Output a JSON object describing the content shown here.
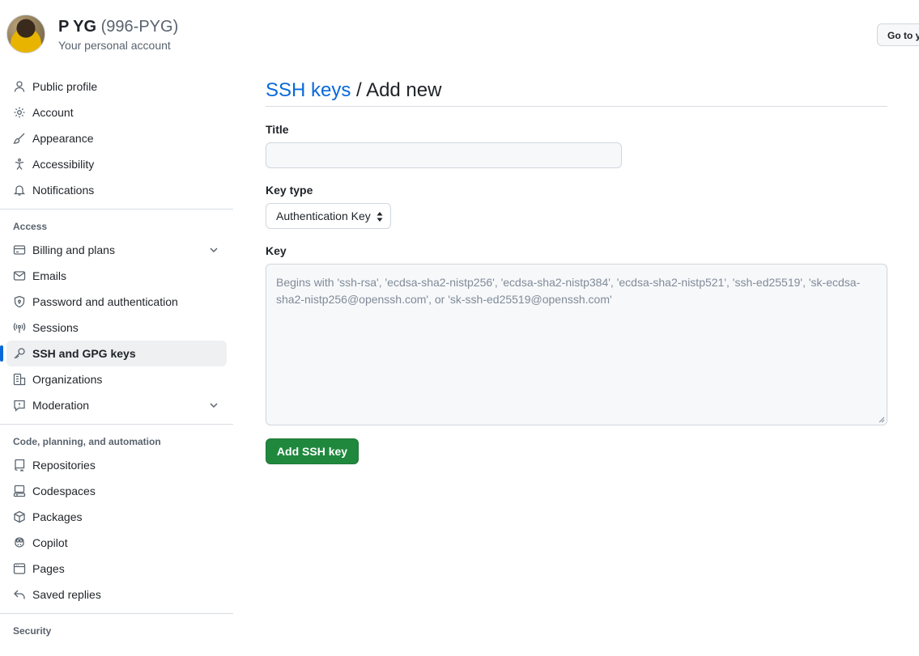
{
  "header": {
    "user_name": "P YG",
    "user_handle": "(996-PYG)",
    "account_sub": "Your personal account",
    "goto_label": "Go to your personal profile"
  },
  "sidebar": {
    "primary": [
      {
        "label": "Public profile",
        "icon": "person-icon"
      },
      {
        "label": "Account",
        "icon": "gear-icon"
      },
      {
        "label": "Appearance",
        "icon": "paintbrush-icon"
      },
      {
        "label": "Accessibility",
        "icon": "accessibility-icon"
      },
      {
        "label": "Notifications",
        "icon": "bell-icon"
      }
    ],
    "access_title": "Access",
    "access": [
      {
        "label": "Billing and plans",
        "icon": "credit-card-icon"
      },
      {
        "label": "Emails",
        "icon": "mail-icon"
      },
      {
        "label": "Password and authentication",
        "icon": "shield-lock-icon"
      },
      {
        "label": "Sessions",
        "icon": "broadcast-icon"
      },
      {
        "label": "SSH and GPG keys",
        "icon": "key-icon"
      },
      {
        "label": "Organizations",
        "icon": "organization-icon"
      },
      {
        "label": "Moderation",
        "icon": "report-icon"
      }
    ],
    "code_title": "Code, planning, and automation",
    "code": [
      {
        "label": "Repositories",
        "icon": "repo-icon"
      },
      {
        "label": "Codespaces",
        "icon": "codespaces-icon"
      },
      {
        "label": "Packages",
        "icon": "package-icon"
      },
      {
        "label": "Copilot",
        "icon": "copilot-icon"
      },
      {
        "label": "Pages",
        "icon": "browser-icon"
      },
      {
        "label": "Saved replies",
        "icon": "reply-icon"
      }
    ],
    "security_title": "Security",
    "active_item": "SSH and GPG keys"
  },
  "main": {
    "breadcrumb_link": "SSH keys",
    "breadcrumb_sep": " / ",
    "breadcrumb_current": "Add new",
    "title_label": "Title",
    "title_value": "",
    "key_type_label": "Key type",
    "key_type_selected": "Authentication Key",
    "key_label": "Key",
    "key_placeholder": "Begins with 'ssh-rsa', 'ecdsa-sha2-nistp256', 'ecdsa-sha2-nistp384', 'ecdsa-sha2-nistp521', 'ssh-ed25519', 'sk-ecdsa-sha2-nistp256@openssh.com', or 'sk-ssh-ed25519@openssh.com'",
    "submit_label": "Add SSH key"
  },
  "colors": {
    "link": "#0969da",
    "primary_button": "#1f883d",
    "active_indicator": "#0969da"
  }
}
